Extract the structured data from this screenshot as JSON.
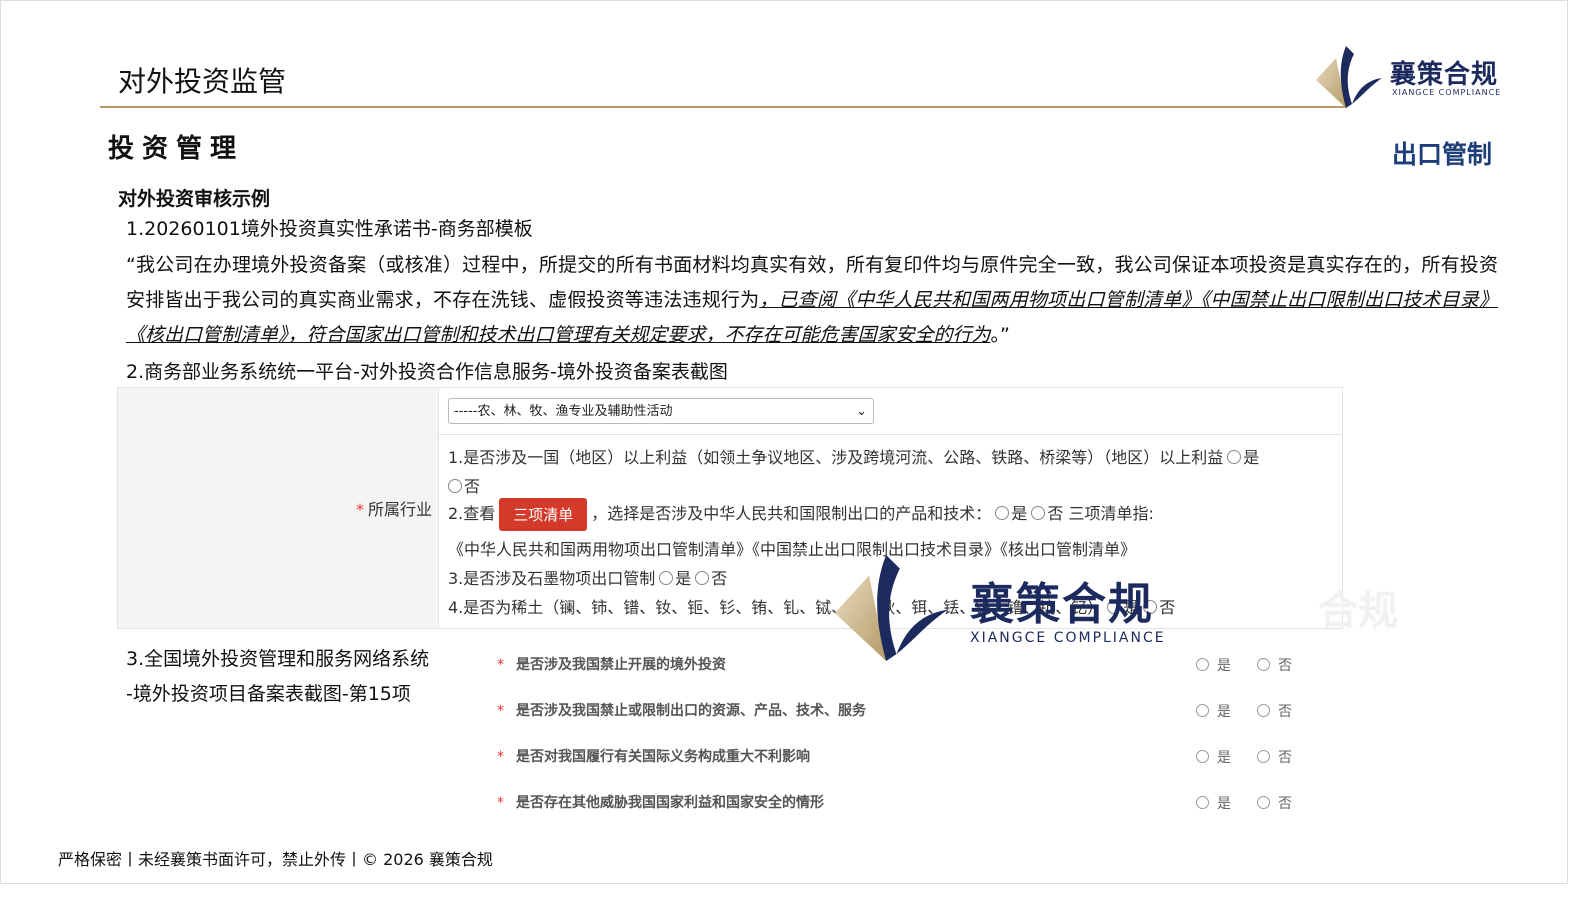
{
  "header": {
    "section_title": "对外投资监管",
    "logo_cn": "襄策合规",
    "logo_en": "XIANGCE COMPLIANCE"
  },
  "subtitle": "投资管理",
  "tag": "出口管制",
  "example_title": "对外投资审核示例",
  "item1": {
    "title": "1.20260101境外投资真实性承诺书-商务部模板",
    "quote_plain": "“我公司在办理境外投资备案（或核准）过程中，所提交的所有书面材料均真实有效，所有复印件均与原件完全一致，我公司保证本项投资是真实存在的，所有投资安排皆出于我公司的真实商业需求，不存在洗钱、虚假投资等违法违规行为",
    "quote_underlined": "，已查阅《中华人民共和国两用物项出口管制清单》《中国禁止出口限制出口技术目录》《核出口管制清单》，符合国家出口管制和技术出口管理有关规定要求，不存在可能危害国家安全的行为",
    "quote_end": "。”"
  },
  "item2": {
    "title": "2.商务部业务系统统一平台-对外投资合作信息服务-境外投资备案表截图",
    "form": {
      "label_star": "*",
      "label": "所属行业",
      "select_value": "-----农、林、牧、渔专业及辅助性活动",
      "q1_text": "1.是否涉及一国（地区）以上利益（如领土争议地区、涉及跨境河流、公路、铁路、桥梁等）（地区）以上利益",
      "q1_yes": "是",
      "q1_no": "否",
      "q2_prefix": "2.查看",
      "q2_button": "三项清单",
      "q2_text": "，选择是否涉及中华人民共和国限制出口的产品和技术：",
      "q2_yes": "是",
      "q2_no": "否",
      "q2_suffix": "三项清单指:",
      "q2_list": "《中华人民共和国两用物项出口管制清单》《中国禁止出口限制出口技术目录》《核出口管制清单》",
      "q3_text": "3.是否涉及石墨物项出口管制",
      "q3_yes": "是",
      "q3_no": "否",
      "q4_text": "4.是否为稀土（镧、铈、镨、钕、钷、钐、铕、钆、铽、镝、钬、铒、铥、镱、镥、钪、钇）",
      "q4_yes": "是",
      "q4_no": "否"
    }
  },
  "item3": {
    "title_line1": "3.全国境外投资管理和服务网络系统",
    "title_line2": "-境外投资项目备案表截图-第15项",
    "star": "*",
    "yes": "是",
    "no": "否",
    "questions": [
      "是否涉及我国禁止开展的境外投资",
      "是否涉及我国禁止或限制出口的资源、产品、技术、服务",
      "是否对我国履行有关国际义务构成重大不利影响",
      "是否存在其他威胁我国国家利益和国家安全的情形"
    ]
  },
  "watermark": {
    "cn": "襄策合规",
    "en": "XIANGCE COMPLIANCE",
    "ghost": "合规"
  },
  "footer": "严格保密丨未经襄策书面许可，禁止外传丨© 2026 襄策合规",
  "colors": {
    "brand_navy": "#1d2a5e",
    "brand_gold": "#b49a66",
    "tag_blue": "#1d3e7a",
    "button_red": "#d43a2a",
    "required_star": "#ee3333"
  }
}
